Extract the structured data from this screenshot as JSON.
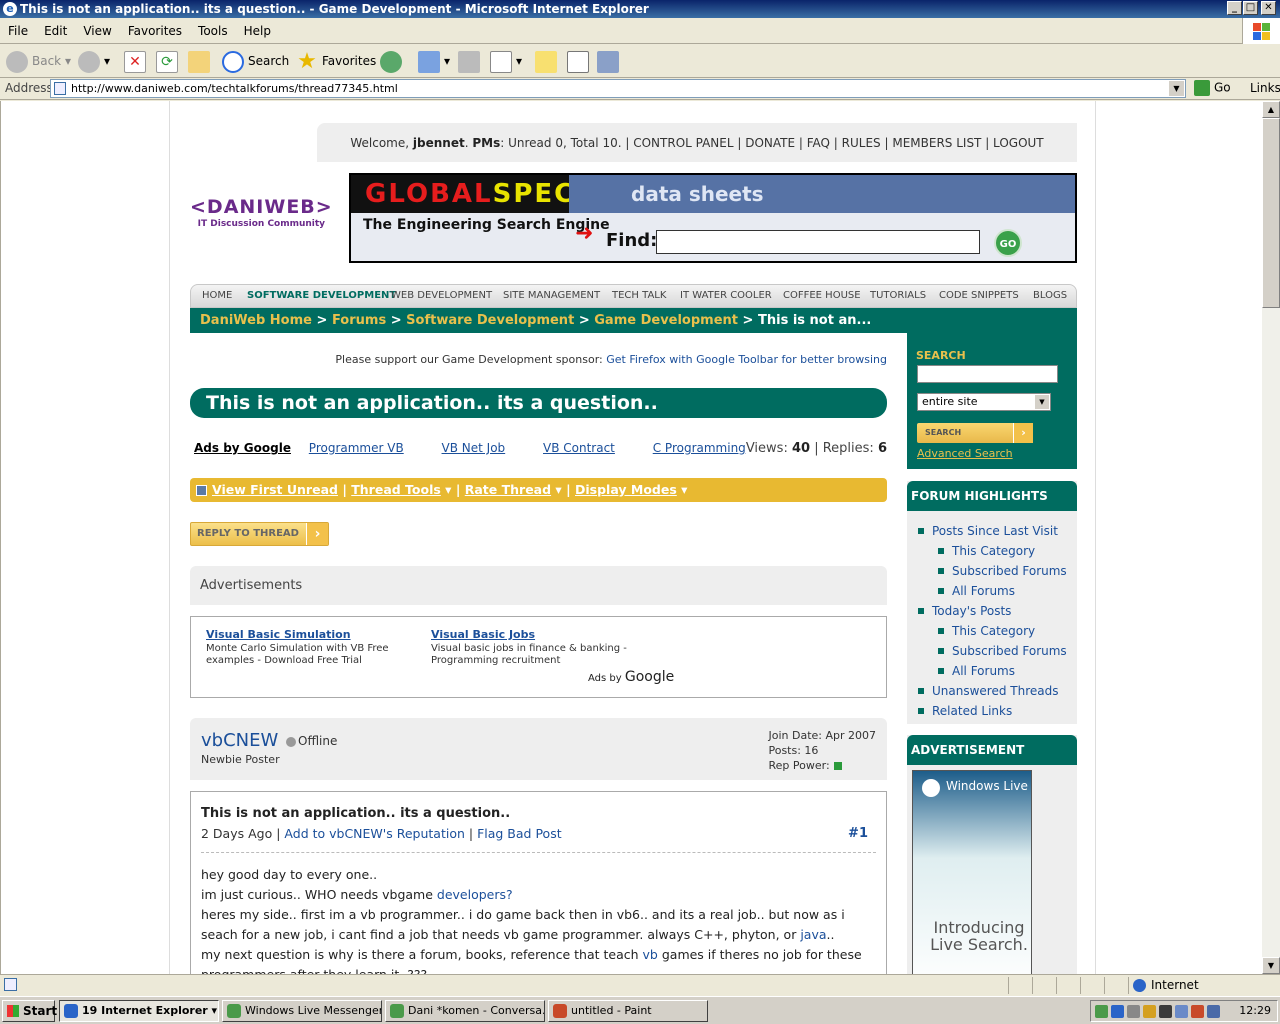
{
  "window": {
    "title": "This is not an application.. its a question.. - Game Development - Microsoft Internet Explorer",
    "controls": [
      "_",
      "□",
      "✕"
    ]
  },
  "menu": [
    "File",
    "Edit",
    "View",
    "Favorites",
    "Tools",
    "Help"
  ],
  "toolbar": {
    "back": "Back",
    "search": "Search",
    "favorites": "Favorites"
  },
  "address": {
    "label": "Address",
    "url": "http://www.daniweb.com/techtalkforums/thread77345.html",
    "go": "Go",
    "links": "Links"
  },
  "page": {
    "welcome": {
      "prefix": "Welcome,",
      "user": "jbennet",
      "pms_label": "PMs",
      "pms_text": ": Unread 0, Total 10. |",
      "links": "CONTROL PANEL | DONATE | FAQ | RULES | MEMBERS LIST | LOGOUT"
    },
    "logo": {
      "name": "<DANIWEB>",
      "tagline": "IT Discussion Community"
    },
    "banner": {
      "brand_a": "GLOBAL",
      "brand_b": "SPEC",
      "product": "data sheets",
      "tagline": "The Engineering Search Engine",
      "find": "Find:",
      "go": "GO"
    },
    "nav": [
      {
        "label": "HOME"
      },
      {
        "label": "SOFTWARE DEVELOPMENT"
      },
      {
        "label": "WEB DEVELOPMENT"
      },
      {
        "label": "SITE MANAGEMENT"
      },
      {
        "label": "TECH TALK"
      },
      {
        "label": "IT WATER COOLER"
      },
      {
        "label": "COFFEE HOUSE"
      },
      {
        "label": "TUTORIALS"
      },
      {
        "label": "CODE SNIPPETS"
      },
      {
        "label": "BLOGS"
      }
    ],
    "breadcrumb": [
      "DaniWeb Home",
      "Forums",
      "Software Development",
      "Game Development"
    ],
    "breadcrumb_sep": ">",
    "breadcrumb_current": "This is not an...",
    "sponsor": {
      "prefix": "Please support our Game Development sponsor:",
      "link": "Get Firefox with Google Toolbar for better browsing"
    },
    "thread_title": "This is not an application.. its a question..",
    "ads_row": {
      "label": "Ads by Google",
      "links": [
        "Programmer VB",
        "VB Net Job",
        "VB Contract",
        "C Programming"
      ]
    },
    "stats": {
      "views_label": "Views:",
      "views": "40",
      "replies_label": "| Replies:",
      "replies": "6"
    },
    "tools": [
      "View First Unread",
      "Thread Tools",
      "Rate Thread",
      "Display Modes"
    ],
    "tools_sep": "|",
    "reply_button": "REPLY TO THREAD",
    "advertisements_heading": "Advertisements",
    "ads": [
      {
        "title": "Visual Basic Simulation",
        "text": "Monte Carlo Simulation with VB Free examples - Download Free Trial"
      },
      {
        "title": "Visual Basic Jobs",
        "text": "Visual basic jobs in finance & banking - Programming recruitment"
      }
    ],
    "ads_brand_prefix": "Ads by",
    "ads_brand": "Google",
    "post": {
      "username": "vbCNEW",
      "status": "Offline",
      "rank": "Newbie Poster",
      "join_date": "Join Date: Apr 2007",
      "posts": "Posts: 16",
      "rep_power": "Rep Power:",
      "title": "This is not an application.. its a question..",
      "time": "2 Days Ago",
      "sep": "|",
      "add_rep": "Add to vbCNEW's Reputation",
      "flag": "Flag Bad Post",
      "number": "#1",
      "lines": {
        "l1": "hey good day to every one..",
        "l2a": "im just curious.. WHO needs vbgame",
        "l2b": "developers?",
        "l3": "heres my side.. first im a vb programmer.. i do game back then in vb6.. and its a real job.. but now as i",
        "l4a": "seach for a new job, i cant find a job that needs vb game programmer. always C++, phyton, or",
        "l4b": "java",
        "l4c": "..",
        "l5a": "my next question is why is there a forum, books, reference that teach",
        "l5b": "vb",
        "l5c": "games if theres no job for these",
        "l6": "programmers after they learn it..???"
      }
    },
    "sidebar": {
      "search_heading": "SEARCH",
      "scope": "entire site",
      "search_button": "SEARCH",
      "advanced": "Advanced Search",
      "highlights_heading": "FORUM HIGHLIGHTS",
      "highlights": [
        {
          "label": "Posts Since Last Visit",
          "level": 1
        },
        {
          "label": "This Category",
          "level": 2
        },
        {
          "label": "Subscribed Forums",
          "level": 2
        },
        {
          "label": "All Forums",
          "level": 2
        },
        {
          "label": "Today's Posts",
          "level": 1
        },
        {
          "label": "This Category",
          "level": 2
        },
        {
          "label": "Subscribed Forums",
          "level": 2
        },
        {
          "label": "All Forums",
          "level": 2
        },
        {
          "label": "Unanswered Threads",
          "level": 1
        },
        {
          "label": "Related Links",
          "level": 1
        }
      ],
      "advertisement_heading": "ADVERTISEMENT",
      "ad_brand": "Windows Live",
      "ad_text": "Introducing Live Search."
    }
  },
  "status": {
    "zone": "Internet"
  },
  "taskbar": {
    "start": "Start",
    "tasks": [
      "19 Internet Explorer",
      "Windows Live Messenger",
      "Dani  *komen - Conversa...",
      "untitled - Paint"
    ],
    "clock": "12:29"
  }
}
